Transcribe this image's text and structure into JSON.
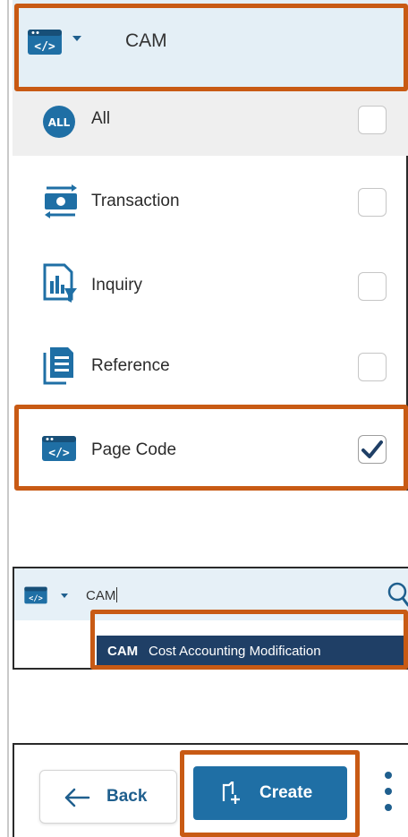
{
  "header": {
    "title": "CAM"
  },
  "menu": {
    "items": [
      {
        "label": "All",
        "checked": false
      },
      {
        "label": "Transaction",
        "checked": false
      },
      {
        "label": "Inquiry",
        "checked": false
      },
      {
        "label": "Reference",
        "checked": false
      },
      {
        "label": "Page Code",
        "checked": true
      }
    ],
    "all_badge": "ALL"
  },
  "search": {
    "value": "CAM",
    "suggestion": {
      "code": "CAM",
      "name": "Cost Accounting Modification"
    }
  },
  "actions": {
    "back_label": "Back",
    "create_label": "Create"
  },
  "colors": {
    "accent": "#1f6fa5",
    "highlight": "#c85a14",
    "suggestion_bg": "#1f3f66"
  }
}
